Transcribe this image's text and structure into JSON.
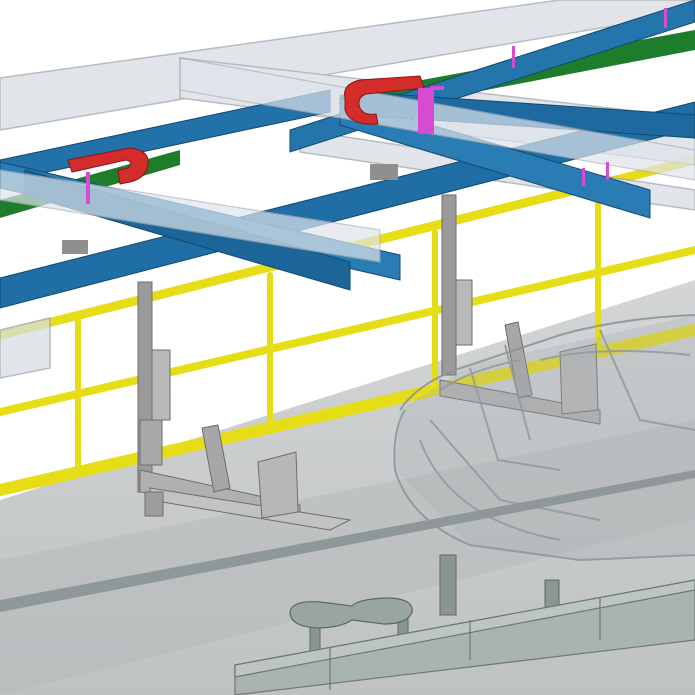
{
  "scene": {
    "colors": {
      "background": "#ffffff",
      "floor": "#c9cbcc",
      "floor_shadow": "#b7babb",
      "rail_blue": "#1f6fa6",
      "rail_blue_dark": "#17557f",
      "rail_green": "#1e7d2a",
      "glass": "#d6dce3",
      "handrail_yellow": "#e8e01a",
      "hanger_gray": "#8e8e8e",
      "carrier_red": "#d32a2a",
      "accent_magenta": "#d64bd0",
      "car_body": "#9aa0a4",
      "conveyor": "#a9b3b1",
      "conveyor_edge": "#7e8a88"
    }
  }
}
